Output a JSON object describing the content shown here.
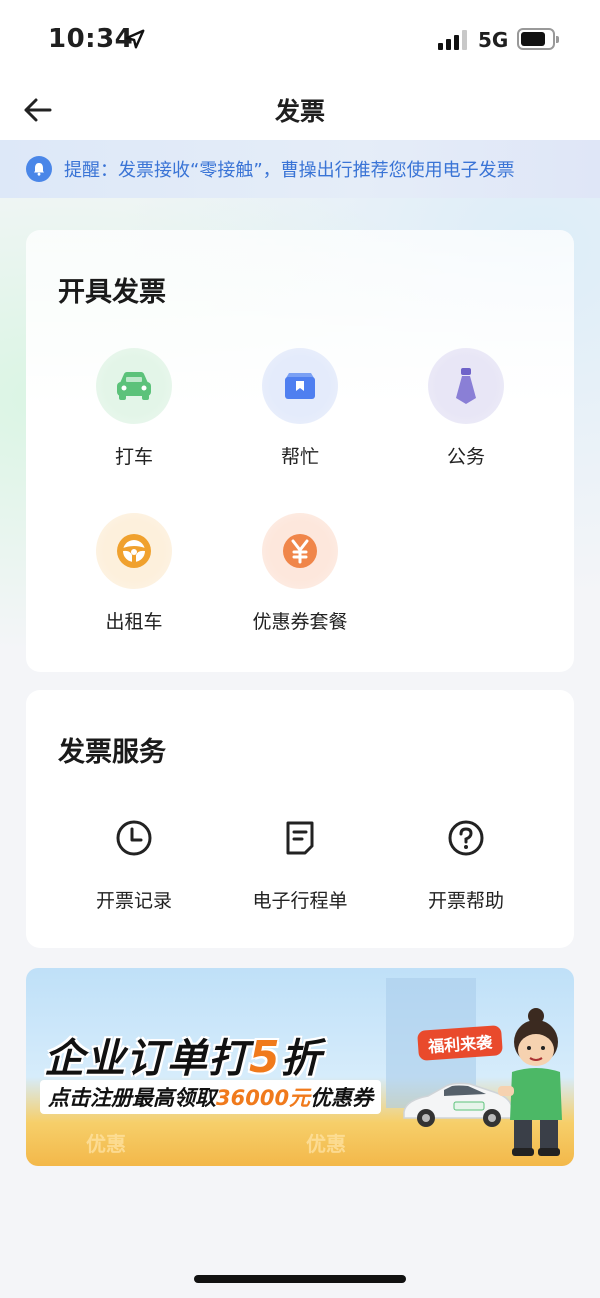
{
  "status_bar": {
    "time": "10:34",
    "network": "5G",
    "location_icon": "location-arrow-icon",
    "signal_icon": "signal-bars-icon",
    "battery_icon": "battery-icon"
  },
  "nav": {
    "title": "发票",
    "back_icon": "arrow-left-icon"
  },
  "notice": {
    "icon": "bell-icon",
    "text": "提醒：发票接收“零接触”，曹操出行推荐您使用电子发票"
  },
  "invoice_card": {
    "title": "开具发票",
    "items": [
      {
        "label": "打车",
        "icon": "car-icon",
        "color": "#5cc27a"
      },
      {
        "label": "帮忙",
        "icon": "bookmark-box-icon",
        "color": "#4f7ff0"
      },
      {
        "label": "公务",
        "icon": "necktie-icon",
        "color": "#8a7fd6"
      },
      {
        "label": "出租车",
        "icon": "steering-wheel-icon",
        "color": "#f0a12e"
      },
      {
        "label": "优惠券套餐",
        "icon": "yuan-coin-icon",
        "color": "#f0864a"
      }
    ]
  },
  "service_card": {
    "title": "发票服务",
    "items": [
      {
        "label": "开票记录",
        "icon": "clock-icon"
      },
      {
        "label": "电子行程单",
        "icon": "document-icon"
      },
      {
        "label": "开票帮助",
        "icon": "question-circle-icon"
      }
    ]
  },
  "banner": {
    "headline_prefix": "企业订单打",
    "headline_highlight": "5",
    "headline_suffix": "折",
    "sub_prefix": "点击注册最高领取",
    "sub_highlight": "36000元",
    "sub_suffix": "优惠券",
    "tag": "福利来袭",
    "ground_text_1": "优惠",
    "ground_text_2": "优惠",
    "accent_color": "#f07a1c"
  }
}
